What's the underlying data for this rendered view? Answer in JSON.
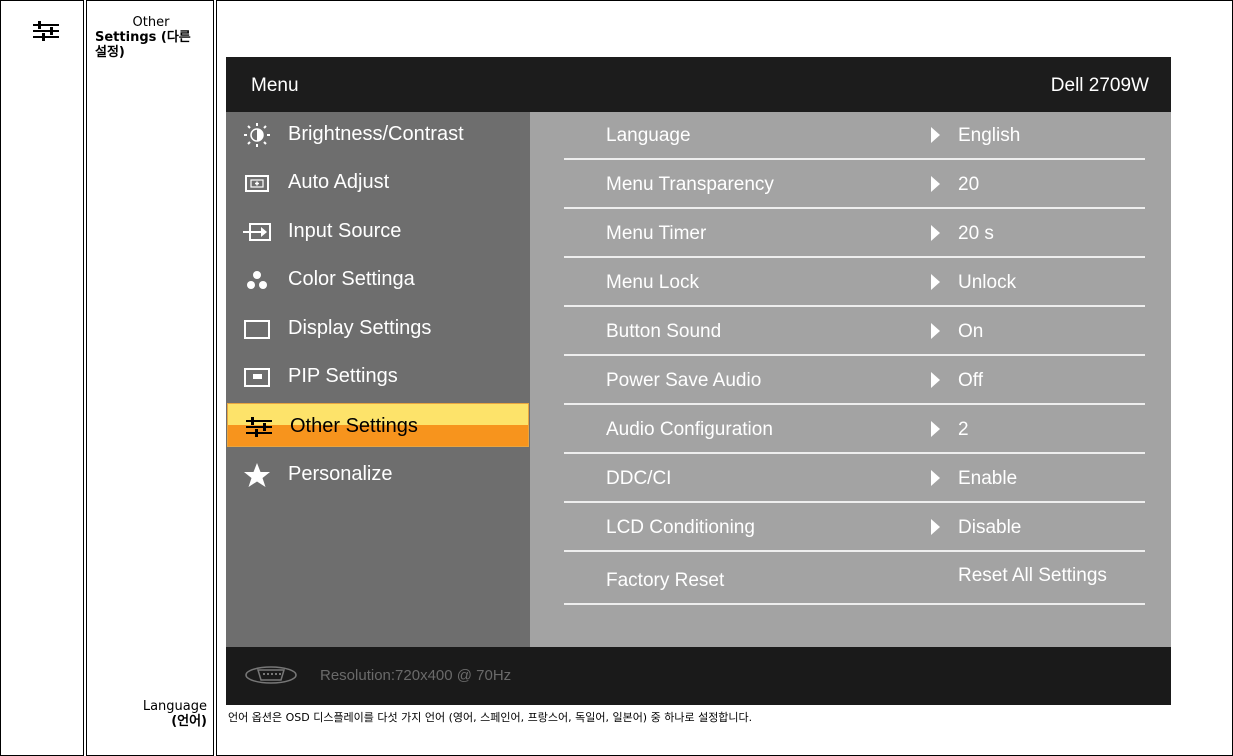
{
  "category": {
    "icon": "sliders-icon",
    "label_line1": "Other",
    "label_rest": "Settings (다른 설정)"
  },
  "submenu_label": {
    "name": "Language",
    "korean": "(언어)"
  },
  "osd": {
    "title": "Menu",
    "model": "Dell 2709W",
    "menu_items": [
      {
        "icon": "brightness-icon",
        "label": "Brightness/Contrast"
      },
      {
        "icon": "auto-adjust-icon",
        "label": "Auto Adjust"
      },
      {
        "icon": "input-source-icon",
        "label": "Input Source"
      },
      {
        "icon": "color-dots-icon",
        "label": "Color Settinga"
      },
      {
        "icon": "display-icon",
        "label": "Display Settings"
      },
      {
        "icon": "pip-icon",
        "label": "PIP Settings"
      },
      {
        "icon": "sliders-icon",
        "label": "Other Settings"
      },
      {
        "icon": "star-icon",
        "label": "Personalize"
      }
    ],
    "selected_index": 6,
    "options": [
      {
        "name": "Language",
        "value": "English"
      },
      {
        "name": "Menu Transparency",
        "value": "20"
      },
      {
        "name": "Menu Timer",
        "value": "20 s"
      },
      {
        "name": "Menu Lock",
        "value": "Unlock"
      },
      {
        "name": "Button Sound",
        "value": "On"
      },
      {
        "name": "Power Save Audio",
        "value": "Off"
      },
      {
        "name": "Audio Configuration",
        "value": "2"
      },
      {
        "name": "DDC/CI",
        "value": "Enable"
      },
      {
        "name": "LCD Conditioning",
        "value": "Disable"
      },
      {
        "name": "Factory Reset",
        "value": "Reset All Settings"
      }
    ],
    "footer": {
      "icon": "vga-connector-icon",
      "resolution": "Resolution:720x400 @ 70Hz"
    },
    "colors": {
      "highlight_top": "#fde36a",
      "highlight_bottom": "#f7941d",
      "left_panel": "#6e6e6e",
      "right_panel": "#a3a3a3"
    }
  },
  "description": "언어 옵션은 OSD 디스플레이를 다섯 가지 언어 (영어, 스페인어, 프랑스어, 독일어, 일본어) 중 하나로 설정합니다."
}
